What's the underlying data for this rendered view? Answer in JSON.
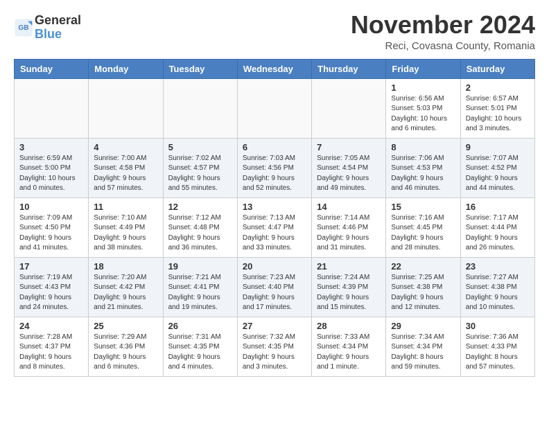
{
  "header": {
    "logo_line1": "General",
    "logo_line2": "Blue",
    "month": "November 2024",
    "location": "Reci, Covasna County, Romania"
  },
  "weekdays": [
    "Sunday",
    "Monday",
    "Tuesday",
    "Wednesday",
    "Thursday",
    "Friday",
    "Saturday"
  ],
  "rows": [
    [
      {
        "day": "",
        "info": ""
      },
      {
        "day": "",
        "info": ""
      },
      {
        "day": "",
        "info": ""
      },
      {
        "day": "",
        "info": ""
      },
      {
        "day": "",
        "info": ""
      },
      {
        "day": "1",
        "info": "Sunrise: 6:56 AM\nSunset: 5:03 PM\nDaylight: 10 hours\nand 6 minutes."
      },
      {
        "day": "2",
        "info": "Sunrise: 6:57 AM\nSunset: 5:01 PM\nDaylight: 10 hours\nand 3 minutes."
      }
    ],
    [
      {
        "day": "3",
        "info": "Sunrise: 6:59 AM\nSunset: 5:00 PM\nDaylight: 10 hours\nand 0 minutes."
      },
      {
        "day": "4",
        "info": "Sunrise: 7:00 AM\nSunset: 4:58 PM\nDaylight: 9 hours\nand 57 minutes."
      },
      {
        "day": "5",
        "info": "Sunrise: 7:02 AM\nSunset: 4:57 PM\nDaylight: 9 hours\nand 55 minutes."
      },
      {
        "day": "6",
        "info": "Sunrise: 7:03 AM\nSunset: 4:56 PM\nDaylight: 9 hours\nand 52 minutes."
      },
      {
        "day": "7",
        "info": "Sunrise: 7:05 AM\nSunset: 4:54 PM\nDaylight: 9 hours\nand 49 minutes."
      },
      {
        "day": "8",
        "info": "Sunrise: 7:06 AM\nSunset: 4:53 PM\nDaylight: 9 hours\nand 46 minutes."
      },
      {
        "day": "9",
        "info": "Sunrise: 7:07 AM\nSunset: 4:52 PM\nDaylight: 9 hours\nand 44 minutes."
      }
    ],
    [
      {
        "day": "10",
        "info": "Sunrise: 7:09 AM\nSunset: 4:50 PM\nDaylight: 9 hours\nand 41 minutes."
      },
      {
        "day": "11",
        "info": "Sunrise: 7:10 AM\nSunset: 4:49 PM\nDaylight: 9 hours\nand 38 minutes."
      },
      {
        "day": "12",
        "info": "Sunrise: 7:12 AM\nSunset: 4:48 PM\nDaylight: 9 hours\nand 36 minutes."
      },
      {
        "day": "13",
        "info": "Sunrise: 7:13 AM\nSunset: 4:47 PM\nDaylight: 9 hours\nand 33 minutes."
      },
      {
        "day": "14",
        "info": "Sunrise: 7:14 AM\nSunset: 4:46 PM\nDaylight: 9 hours\nand 31 minutes."
      },
      {
        "day": "15",
        "info": "Sunrise: 7:16 AM\nSunset: 4:45 PM\nDaylight: 9 hours\nand 28 minutes."
      },
      {
        "day": "16",
        "info": "Sunrise: 7:17 AM\nSunset: 4:44 PM\nDaylight: 9 hours\nand 26 minutes."
      }
    ],
    [
      {
        "day": "17",
        "info": "Sunrise: 7:19 AM\nSunset: 4:43 PM\nDaylight: 9 hours\nand 24 minutes."
      },
      {
        "day": "18",
        "info": "Sunrise: 7:20 AM\nSunset: 4:42 PM\nDaylight: 9 hours\nand 21 minutes."
      },
      {
        "day": "19",
        "info": "Sunrise: 7:21 AM\nSunset: 4:41 PM\nDaylight: 9 hours\nand 19 minutes."
      },
      {
        "day": "20",
        "info": "Sunrise: 7:23 AM\nSunset: 4:40 PM\nDaylight: 9 hours\nand 17 minutes."
      },
      {
        "day": "21",
        "info": "Sunrise: 7:24 AM\nSunset: 4:39 PM\nDaylight: 9 hours\nand 15 minutes."
      },
      {
        "day": "22",
        "info": "Sunrise: 7:25 AM\nSunset: 4:38 PM\nDaylight: 9 hours\nand 12 minutes."
      },
      {
        "day": "23",
        "info": "Sunrise: 7:27 AM\nSunset: 4:38 PM\nDaylight: 9 hours\nand 10 minutes."
      }
    ],
    [
      {
        "day": "24",
        "info": "Sunrise: 7:28 AM\nSunset: 4:37 PM\nDaylight: 9 hours\nand 8 minutes."
      },
      {
        "day": "25",
        "info": "Sunrise: 7:29 AM\nSunset: 4:36 PM\nDaylight: 9 hours\nand 6 minutes."
      },
      {
        "day": "26",
        "info": "Sunrise: 7:31 AM\nSunset: 4:35 PM\nDaylight: 9 hours\nand 4 minutes."
      },
      {
        "day": "27",
        "info": "Sunrise: 7:32 AM\nSunset: 4:35 PM\nDaylight: 9 hours\nand 3 minutes."
      },
      {
        "day": "28",
        "info": "Sunrise: 7:33 AM\nSunset: 4:34 PM\nDaylight: 9 hours\nand 1 minute."
      },
      {
        "day": "29",
        "info": "Sunrise: 7:34 AM\nSunset: 4:34 PM\nDaylight: 8 hours\nand 59 minutes."
      },
      {
        "day": "30",
        "info": "Sunrise: 7:36 AM\nSunset: 4:33 PM\nDaylight: 8 hours\nand 57 minutes."
      }
    ]
  ]
}
